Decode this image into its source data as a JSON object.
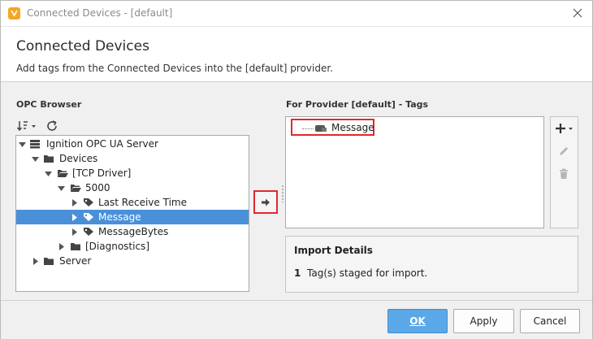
{
  "window": {
    "title": "Connected Devices - [default]"
  },
  "header": {
    "title": "Connected Devices",
    "description": "Add tags from the Connected Devices into the [default] provider."
  },
  "opc_browser": {
    "label": "OPC Browser",
    "toolbar": {
      "sort_icon": "sort-icon",
      "refresh_icon": "refresh-icon"
    },
    "tree": [
      {
        "label": "Ignition OPC UA Server",
        "icon": "server-icon",
        "expanded": true,
        "level": 0
      },
      {
        "label": "Devices",
        "icon": "folder-icon",
        "expanded": true,
        "level": 1
      },
      {
        "label": "[TCP Driver]",
        "icon": "folder-open-icon",
        "expanded": true,
        "level": 2
      },
      {
        "label": "5000",
        "icon": "folder-open-icon",
        "expanded": true,
        "level": 3
      },
      {
        "label": "Last Receive Time",
        "icon": "tag-icon",
        "expanded": false,
        "level": 4
      },
      {
        "label": "Message",
        "icon": "tag-icon",
        "expanded": false,
        "level": 4,
        "selected": true
      },
      {
        "label": "MessageBytes",
        "icon": "tag-icon",
        "expanded": false,
        "level": 4
      },
      {
        "label": "[Diagnostics]",
        "icon": "folder-icon",
        "expanded": false,
        "level": 3
      },
      {
        "label": "Server",
        "icon": "folder-icon",
        "expanded": false,
        "level": 1
      }
    ]
  },
  "provider": {
    "label": "For Provider [default] - Tags",
    "tags": [
      {
        "label": "Message",
        "icon": "tag-device-icon"
      }
    ]
  },
  "import_details": {
    "title": "Import Details",
    "count": "1",
    "text": "Tag(s) staged for import."
  },
  "footer": {
    "ok_label": "OK",
    "apply_label": "Apply",
    "cancel_label": "Cancel"
  },
  "colors": {
    "selection": "#4a90d9",
    "highlight": "#e0282e",
    "primary_button": "#5aa8e8",
    "app_icon": "#f5a623"
  }
}
